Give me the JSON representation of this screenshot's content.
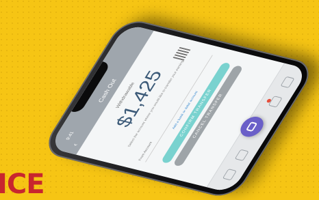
{
  "background": {
    "color": "#f6c514",
    "dots_color": "#d9a90c"
  },
  "corner_text": "ICE",
  "phone": {
    "status_left": "9:41",
    "header_title": "Cash Out",
    "balance_label": "Withdrawable",
    "balance": "$1,425",
    "description": "Select the account where you would like to transfer your earnings",
    "from_label": "From Account",
    "link_text": "Add a bank or debit account",
    "primary_button": "CONFIRM TRANSFER",
    "secondary_button": "CANCEL TRANSFER",
    "colors": {
      "primary": "#79d2cf",
      "fab": "#6a5fc8",
      "header": "#9fa6ad",
      "balance": "#3c5a78"
    },
    "icons": [
      "back-icon",
      "qr-icon",
      "home-icon",
      "wallet-icon",
      "camera-icon",
      "bell-icon",
      "profile-icon"
    ]
  }
}
